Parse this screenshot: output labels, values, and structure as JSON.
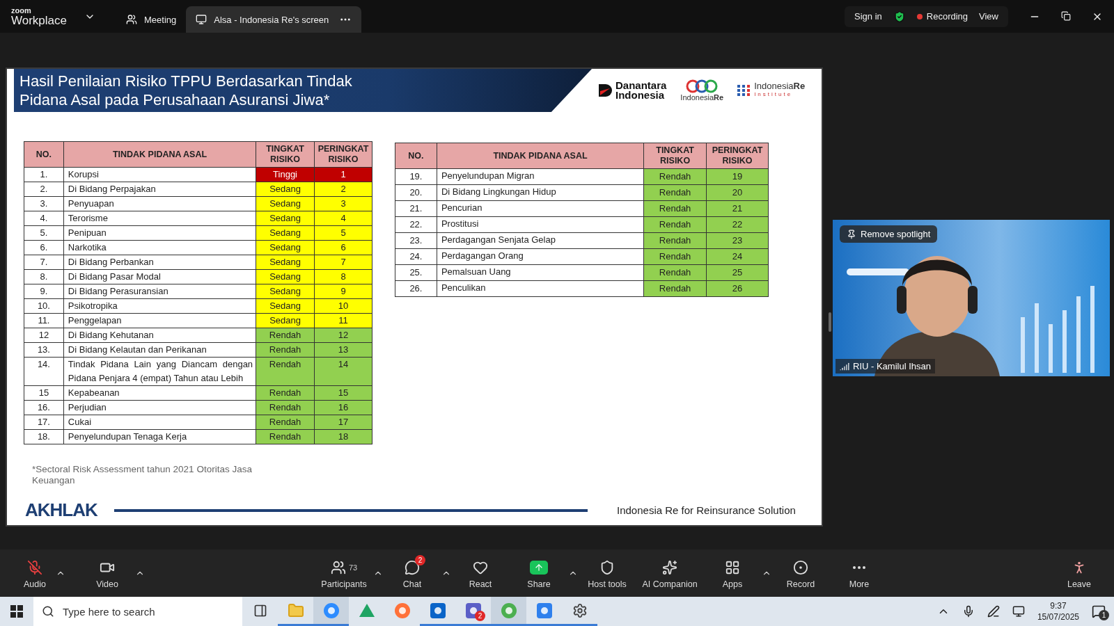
{
  "titlebar": {
    "logo_small": "zoom",
    "logo_large": "Workplace",
    "tabs": [
      {
        "label": "Meeting",
        "selected": false
      },
      {
        "label": "Alsa - Indonesia Re's screen",
        "selected": true
      }
    ],
    "sign_in": "Sign in",
    "recording": "Recording",
    "view": "View"
  },
  "slide": {
    "title_lines": [
      "Hasil Penilaian Risiko TPPU Berdasarkan Tindak",
      "Pidana Asal pada Perusahaan Asuransi Jiwa*"
    ],
    "logos": {
      "danantara": [
        "Danantara",
        "Indonesia"
      ],
      "indonesiare": [
        "Indonesia",
        "Re"
      ],
      "institute": [
        "Indonesia",
        "Re",
        "Institute"
      ]
    },
    "tables": [
      {
        "columns": [
          "NO.",
          "TINDAK PIDANA ASAL",
          "TINGKAT RISIKO",
          "PERINGKAT RISIKO"
        ],
        "rows": [
          {
            "no": "1.",
            "name": "Korupsi",
            "level": "Tinggi",
            "rank": "1",
            "color": "#c00000"
          },
          {
            "no": "2.",
            "name": "Di Bidang Perpajakan",
            "level": "Sedang",
            "rank": "2",
            "color": "#ffff00"
          },
          {
            "no": "3.",
            "name": "Penyuapan",
            "level": "Sedang",
            "rank": "3",
            "color": "#ffff00"
          },
          {
            "no": "4.",
            "name": "Terorisme",
            "level": "Sedang",
            "rank": "4",
            "color": "#ffff00"
          },
          {
            "no": "5.",
            "name": "Penipuan",
            "level": "Sedang",
            "rank": "5",
            "color": "#ffff00"
          },
          {
            "no": "6.",
            "name": "Narkotika",
            "level": "Sedang",
            "rank": "6",
            "color": "#ffff00"
          },
          {
            "no": "7.",
            "name": "Di Bidang Perbankan",
            "level": "Sedang",
            "rank": "7",
            "color": "#ffff00"
          },
          {
            "no": "8.",
            "name": "Di Bidang Pasar Modal",
            "level": "Sedang",
            "rank": "8",
            "color": "#ffff00"
          },
          {
            "no": "9.",
            "name": "Di Bidang Perasuransian",
            "level": "Sedang",
            "rank": "9",
            "color": "#ffff00"
          },
          {
            "no": "10.",
            "name": "Psikotropika",
            "level": "Sedang",
            "rank": "10",
            "color": "#ffff00"
          },
          {
            "no": "11.",
            "name": "Penggelapan",
            "level": "Sedang",
            "rank": "11",
            "color": "#ffff00"
          },
          {
            "no": "12",
            "name": "Di Bidang Kehutanan",
            "level": "Rendah",
            "rank": "12",
            "color": "#92d050"
          },
          {
            "no": "13.",
            "name": "Di Bidang Kelautan dan Perikanan",
            "level": "Rendah",
            "rank": "13",
            "color": "#92d050"
          },
          {
            "no": "14.",
            "name": "Tindak Pidana Lain yang Diancam dengan Pidana Penjara 4 (empat) Tahun atau Lebih",
            "level": "Rendah",
            "rank": "14",
            "color": "#92d050"
          },
          {
            "no": "15",
            "name": "Kepabeanan",
            "level": "Rendah",
            "rank": "15",
            "color": "#92d050"
          },
          {
            "no": "16.",
            "name": "Perjudian",
            "level": "Rendah",
            "rank": "16",
            "color": "#92d050"
          },
          {
            "no": "17.",
            "name": "Cukai",
            "level": "Rendah",
            "rank": "17",
            "color": "#92d050"
          },
          {
            "no": "18.",
            "name": "Penyelundupan Tenaga Kerja",
            "level": "Rendah",
            "rank": "18",
            "color": "#92d050"
          }
        ]
      },
      {
        "columns": [
          "NO.",
          "TINDAK PIDANA ASAL",
          "TINGKAT RISIKO",
          "PERINGKAT RISIKO"
        ],
        "rows": [
          {
            "no": "19.",
            "name": "Penyelundupan Migran",
            "level": "Rendah",
            "rank": "19",
            "color": "#92d050"
          },
          {
            "no": "20.",
            "name": "Di Bidang Lingkungan Hidup",
            "level": "Rendah",
            "rank": "20",
            "color": "#92d050"
          },
          {
            "no": "21.",
            "name": "Pencurian",
            "level": "Rendah",
            "rank": "21",
            "color": "#92d050"
          },
          {
            "no": "22.",
            "name": "Prostitusi",
            "level": "Rendah",
            "rank": "22",
            "color": "#92d050"
          },
          {
            "no": "23.",
            "name": "Perdagangan Senjata Gelap",
            "level": "Rendah",
            "rank": "23",
            "color": "#92d050"
          },
          {
            "no": "24.",
            "name": "Perdagangan Orang",
            "level": "Rendah",
            "rank": "24",
            "color": "#92d050"
          },
          {
            "no": "25.",
            "name": "Pemalsuan Uang",
            "level": "Rendah",
            "rank": "25",
            "color": "#92d050"
          },
          {
            "no": "26.",
            "name": "Penculikan",
            "level": "Rendah",
            "rank": "26",
            "color": "#92d050"
          }
        ]
      }
    ],
    "footnote": "*Sectoral Risk Assessment  tahun 2021  Otoritas Jasa Keuangan",
    "footer_logo": "AKHLAK",
    "tagline": "Indonesia Re for Reinsurance Solution"
  },
  "video": {
    "kind": "picture",
    "spotlight_button": "Remove spotlight",
    "participant": "RIU - Kamilul Ihsan"
  },
  "toolbar": {
    "audio": {
      "label": "Audio",
      "muted": true
    },
    "video": {
      "label": "Video"
    },
    "items": [
      {
        "label": "Participants",
        "count": "73"
      },
      {
        "label": "Chat",
        "badge": "2"
      },
      {
        "label": "React"
      },
      {
        "label": "Share"
      },
      {
        "label": "Host tools"
      },
      {
        "label": "AI Companion"
      },
      {
        "label": "Apps"
      },
      {
        "label": "Record"
      },
      {
        "label": "More"
      }
    ],
    "leave": "Leave"
  },
  "taskbar": {
    "search_placeholder": "Type here to search",
    "apps": [
      {
        "running": true,
        "selected": false
      },
      {
        "running": true,
        "selected": true
      },
      {
        "running": false,
        "selected": false
      },
      {
        "running": false,
        "selected": false
      },
      {
        "running": true,
        "selected": false
      },
      {
        "running": true,
        "selected": false,
        "badge": "2"
      },
      {
        "running": true,
        "selected": true
      },
      {
        "running": true,
        "selected": false
      },
      {
        "running": true,
        "selected": false
      }
    ],
    "time": "9:37",
    "date": "15/07/2025",
    "notifications": "1"
  }
}
